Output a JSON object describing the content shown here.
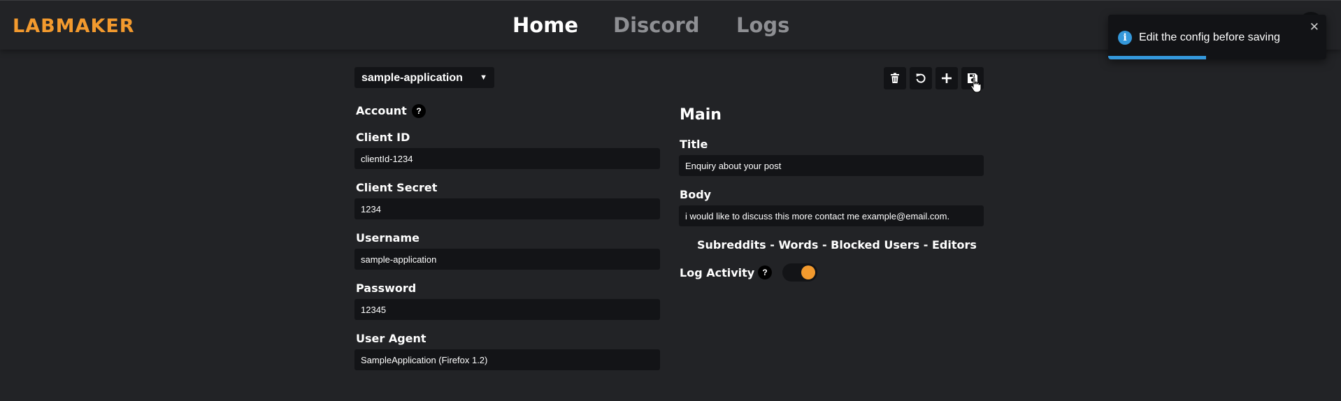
{
  "brand": "LABMAKER",
  "nav": {
    "home": "Home",
    "discord": "Discord",
    "logs": "Logs"
  },
  "toast": {
    "icon": "info-icon",
    "icon_glyph": "i",
    "message": "Edit the config before saving",
    "close_glyph": "✕",
    "progress_fraction": 0.45,
    "color": "#3498db"
  },
  "app_select": {
    "value": "sample-application",
    "caret": "▼"
  },
  "toolbar": {
    "delete_icon": "trash-icon",
    "reset_icon": "undo-icon",
    "add_icon": "plus-icon",
    "save_icon": "save-icon"
  },
  "account": {
    "heading": "Account",
    "help": "?",
    "fields": {
      "client_id": {
        "label": "Client ID",
        "value": "clientId-1234"
      },
      "client_secret": {
        "label": "Client Secret",
        "value": "1234"
      },
      "username": {
        "label": "Username",
        "value": "sample-application"
      },
      "password": {
        "label": "Password",
        "value": "12345"
      },
      "user_agent": {
        "label": "User Agent",
        "value": "SampleApplication (Firefox 1.2)"
      }
    }
  },
  "main": {
    "heading": "Main",
    "fields": {
      "title": {
        "label": "Title",
        "value": "Enquiry about your post"
      },
      "body": {
        "label": "Body",
        "value": "i would like to discuss this more contact me example@email.com."
      }
    },
    "subnav": {
      "subreddits": "Subreddits",
      "words": "Words",
      "blocked_users": "Blocked Users",
      "editors": "Editors",
      "separator": " - "
    },
    "log_activity": {
      "label": "Log Activity",
      "help": "?",
      "enabled": true
    }
  },
  "colors": {
    "accent": "#f39a2e",
    "background": "#222326",
    "input_bg": "#131417",
    "info": "#3498db"
  }
}
